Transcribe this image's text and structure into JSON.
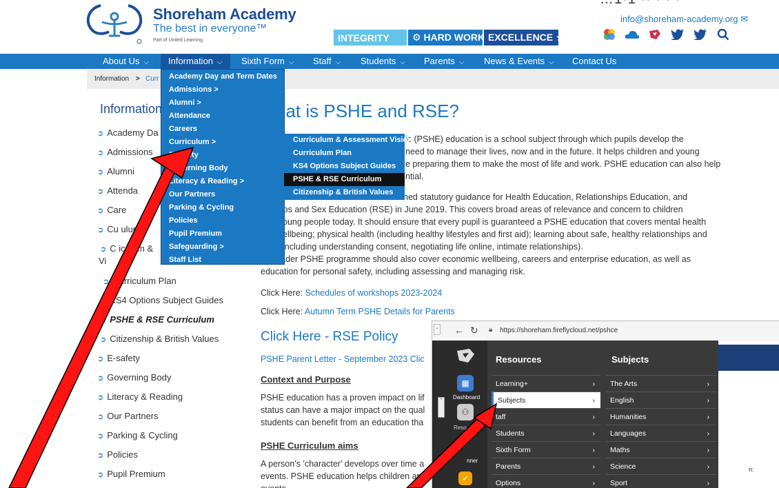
{
  "header": {
    "school_name": "Shoreham Academy",
    "tagline": "The best in everyone™",
    "sub": "Part of United Learning",
    "values": [
      "INTEGRITY",
      "⚙ HARD WORK ✓",
      "EXCELLENCE ★"
    ],
    "email": "info@shoreham-academy.org ✉",
    "phone_partial": "…1·1 ·· · · ·",
    "social_icons": [
      "google-arts-icon",
      "onedrive-icon",
      "firefly-icon",
      "twitter-icon",
      "twitter-icon",
      "search-icon"
    ]
  },
  "nav": [
    {
      "label": "About Us"
    },
    {
      "label": "Information"
    },
    {
      "label": "Sixth Form"
    },
    {
      "label": "Staff"
    },
    {
      "label": "Students"
    },
    {
      "label": "Parents"
    },
    {
      "label": "News & Events"
    },
    {
      "label": "Contact Us"
    }
  ],
  "breadcrumb": {
    "first": "Information",
    "sep": ">",
    "second": "Curr"
  },
  "info_dropdown": [
    "Academy Day and Term Dates",
    "Admissions  >",
    "Alumni  >",
    "Attendance",
    "Careers",
    "Curriculum  >",
    "E-safety",
    "Governing Body",
    "Literacy & Reading  >",
    "Our Partners",
    "Parking & Cycling",
    "Policies",
    "Pupil Premium",
    "Safeguarding  >",
    "Staff List"
  ],
  "curriculum_submenu": [
    "Curriculum & Assessment Vision",
    "Curriculum Plan",
    "KS4 Options Subject Guides",
    "PSHE & RSE Curriculum",
    "Citizenship & British Values"
  ],
  "sidebar": {
    "title": "Information",
    "items": [
      "Academy Da",
      "Admissions",
      "Alumni",
      "Attenda",
      "Care",
      "Cu     ulum",
      "C     iculum &",
      "Curriculum Plan",
      "KS4 Options Subject Guides",
      "PSHE & RSE Curriculum",
      "Citizenship & British Values",
      "E-safety",
      "Governing Body",
      "Literacy & Reading",
      "Our Partners",
      "Parking & Cycling",
      "Policies",
      "Pupil Premium"
    ],
    "wrap_text": "Vi"
  },
  "main": {
    "heading": "hat is PSHE and RSE?",
    "para1": [
      "ic (PSHE) education is a school subject through which pupils develop the",
      "need to manage their lives, now and in the future. It helps children and young",
      "e preparing them to make the most of life and work. PSHE education can also help",
      "ntial."
    ],
    "para2": [
      "hed statutory guidance for Health Education, Relationships Education, and",
      "ionships and Sex Education (RSE) in June 2019. This covers broad areas of relevance and concern to children",
      "oung people today. It should ensure that every pupil is guaranteed a PSHE education that covers mental health",
      "ellbeing; physical health (including healthy lifestyles and first aid); learning about safe, healthy relationships and",
      "including understanding consent, negotiating life online, intimate relationships)."
    ],
    "para3": [
      "A broader PSHE programme should also cover economic wellbeing, careers and enterprise education, as well as",
      "education for personal safety, including assessing and managing risk."
    ],
    "click_here_prefix": "Click Here: ",
    "link1": "Schedules of workshops 2023-2024",
    "link2": "Autumn Term PSHE Details for Parents",
    "rse_policy": "Click Here - RSE Policy",
    "parent_letter": "PSHE Parent Letter - September 2023 Clic",
    "context_heading": "Context and Purpose",
    "context_text": [
      "PSHE education has a proven impact on lif",
      "status can have a major impact on the qual",
      "students can benefit from an education tha"
    ],
    "aims_heading": "PSHE Curriculum aims",
    "aims_text": [
      "A person's 'character' develops over time a",
      "events. PSHE education helps children and",
      "events"
    ]
  },
  "inset": {
    "url": "https://shoreham.fireflycloud.net/pshce",
    "resources_heading": "Resources",
    "subjects_heading": "Subjects",
    "resources": [
      "Learning+",
      "Subjects",
      "taff",
      "Students",
      "Sixth Form",
      "Parents",
      "Options"
    ],
    "subjects": [
      "The Arts",
      "English",
      "Humanities",
      "Languages",
      "Maths",
      "Science",
      "Sport"
    ],
    "rail_labels": [
      "Dashboard",
      "Reso",
      "nner"
    ],
    "right_text": "n:"
  },
  "colors": {
    "nav_blue": "#1b79c4",
    "brand_navy": "#1c4e9a",
    "arrow_red": "#ff0000",
    "highlight_black": "#111111"
  }
}
